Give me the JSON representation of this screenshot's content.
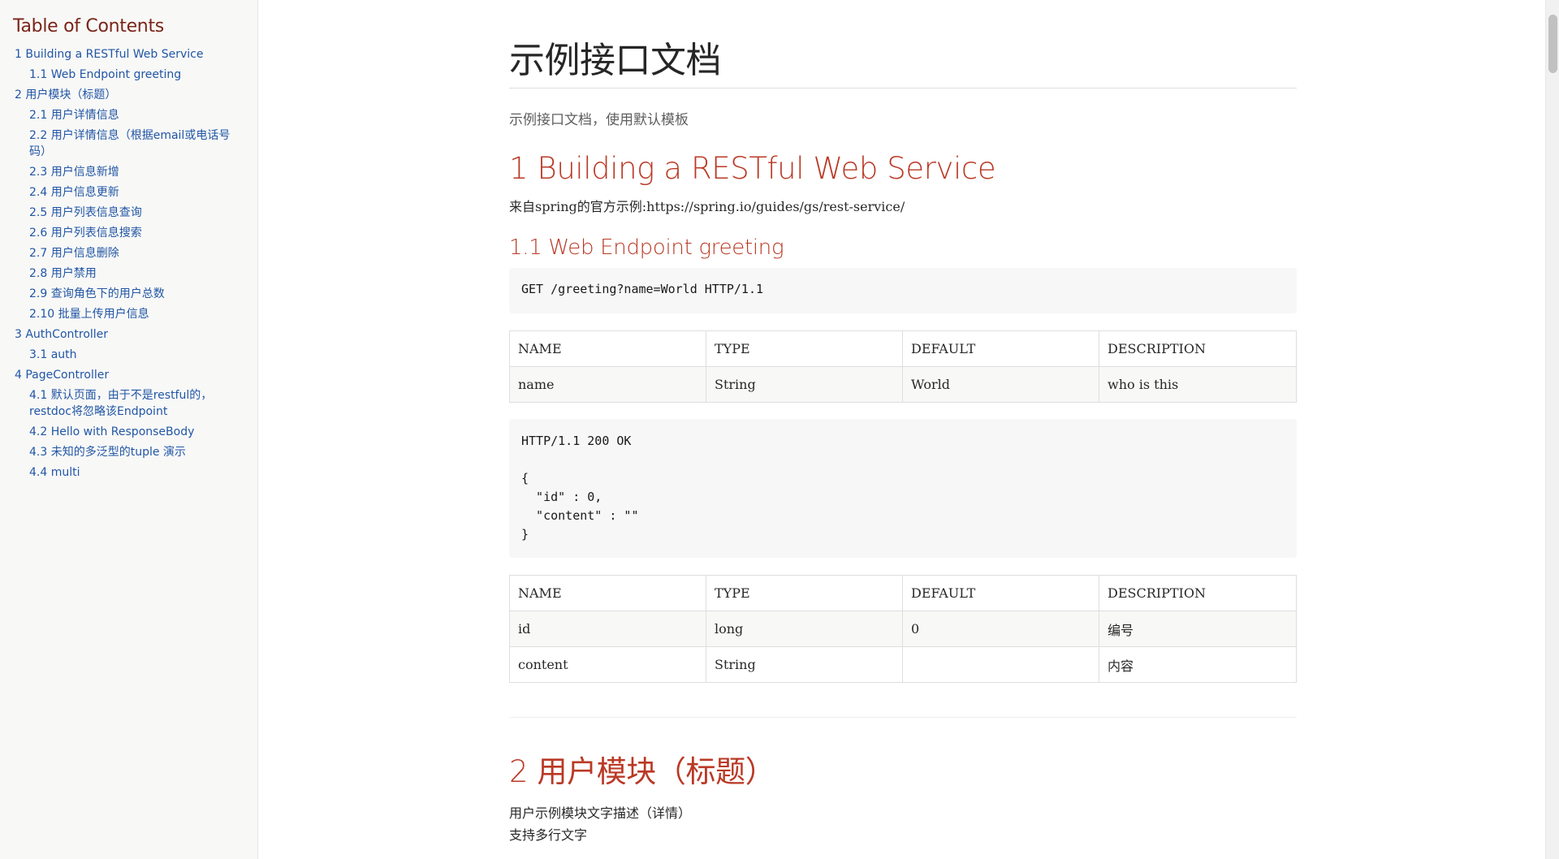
{
  "toc": {
    "title": "Table of Contents",
    "items": [
      {
        "label": "1 Building a RESTful Web Service",
        "level": 1
      },
      {
        "label": "1.1 Web Endpoint greeting",
        "level": 2
      },
      {
        "label": "2 用户模块（标题）",
        "level": 1
      },
      {
        "label": "2.1 用户详情信息",
        "level": 2
      },
      {
        "label": "2.2 用户详情信息（根据email或电话号码）",
        "level": 2
      },
      {
        "label": "2.3 用户信息新增",
        "level": 2
      },
      {
        "label": "2.4 用户信息更新",
        "level": 2
      },
      {
        "label": "2.5 用户列表信息查询",
        "level": 2
      },
      {
        "label": "2.6 用户列表信息搜索",
        "level": 2
      },
      {
        "label": "2.7 用户信息删除",
        "level": 2
      },
      {
        "label": "2.8 用户禁用",
        "level": 2
      },
      {
        "label": "2.9 查询角色下的用户总数",
        "level": 2
      },
      {
        "label": "2.10 批量上传用户信息",
        "level": 2
      },
      {
        "label": "3 AuthController",
        "level": 1
      },
      {
        "label": "3.1 auth",
        "level": 2
      },
      {
        "label": "4 PageController",
        "level": 1
      },
      {
        "label": "4.1 默认页面，由于不是restful的，restdoc将忽略该Endpoint",
        "level": 2
      },
      {
        "label": "4.2 Hello with ResponseBody",
        "level": 2
      },
      {
        "label": "4.3 未知的多泛型的tuple 演示",
        "level": 2
      },
      {
        "label": "4.4 multi",
        "level": 2
      }
    ]
  },
  "doc": {
    "title": "示例接口文档",
    "subtitle": "示例接口文档，使用默认模板",
    "section1": {
      "title": "1 Building a RESTful Web Service",
      "text": "来自spring的官方示例:https://spring.io/guides/gs/rest-service/",
      "sub1": {
        "title": "1.1 Web Endpoint greeting",
        "request": "GET /greeting?name=World HTTP/1.1",
        "params_table": {
          "headers": [
            "NAME",
            "TYPE",
            "DEFAULT",
            "DESCRIPTION"
          ],
          "rows": [
            [
              "name",
              "String",
              "World",
              "who is this"
            ]
          ]
        },
        "response": "HTTP/1.1 200 OK\n\n{\n  \"id\" : 0,\n  \"content\" : \"\"\n}",
        "response_table": {
          "headers": [
            "NAME",
            "TYPE",
            "DEFAULT",
            "DESCRIPTION"
          ],
          "rows": [
            [
              "id",
              "long",
              "0",
              "编号"
            ],
            [
              "content",
              "String",
              "",
              "内容"
            ]
          ]
        }
      }
    },
    "section2": {
      "title": "2 用户模块（标题）",
      "line1": "用户示例模块文字描述（详情）",
      "line2": "支持多行文字"
    }
  }
}
